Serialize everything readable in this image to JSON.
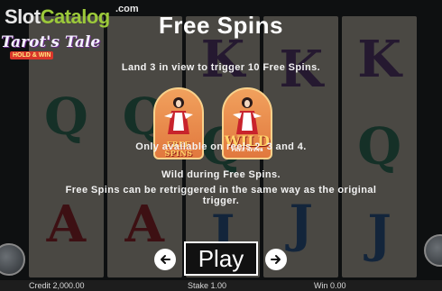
{
  "watermark": {
    "slot": "Slot",
    "catalog": "Catalog",
    "com": ".com"
  },
  "game_logo": {
    "title": "Tarot's Tale",
    "subtitle": "HOLD & WIN"
  },
  "panel": {
    "title": "Free Spins",
    "trigger_text": "Land 3 in view to trigger 10 Free Spins.",
    "reels_text": "Only available on reels 2, 3 and 4.",
    "wild_text": "Wild during Free Spins.",
    "retrigger_text": "Free Spins can be retriggered in the same way as the original trigger."
  },
  "symbols": {
    "free_spins_label": "FREE SPINS",
    "wild_label": "WILD",
    "wild_sub_label": "FREE SPINS"
  },
  "navigation": {
    "play_label": "Play",
    "prev_icon": "arrow-left-icon",
    "next_icon": "arrow-right-icon"
  },
  "bottom_bar": {
    "credit": "Credit  2,000.00",
    "stake": "Stake  1.00",
    "win": "Win  0.00"
  },
  "reel_symbols": [
    [
      "",
      "Q",
      "A"
    ],
    [
      "",
      "Q",
      "A"
    ],
    [
      "K",
      "Q",
      "J"
    ],
    [
      "K",
      "",
      "J"
    ],
    [
      "K",
      "Q",
      "J"
    ]
  ],
  "colors": {
    "overlay": "#000000",
    "title": "#ffffff",
    "catalog_green": "#9cc93a",
    "symbol_orange": "#e1783e"
  }
}
